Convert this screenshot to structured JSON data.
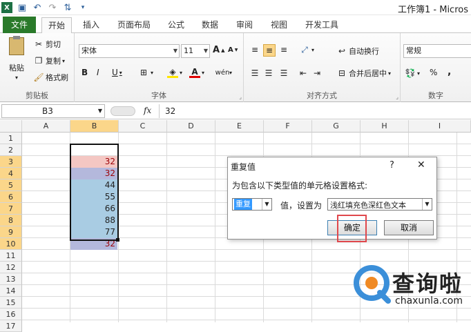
{
  "window": {
    "title": "工作簿1 - Micros"
  },
  "ribbon_tabs": [
    "文件",
    "开始",
    "插入",
    "页面布局",
    "公式",
    "数据",
    "审阅",
    "视图",
    "开发工具"
  ],
  "clipboard": {
    "paste": "粘贴",
    "cut": "剪切",
    "copy": "复制",
    "format_painter": "格式刷",
    "group": "剪贴板"
  },
  "font": {
    "name": "宋体",
    "size": "11",
    "grow": "A",
    "shrink": "A",
    "bold": "B",
    "italic": "I",
    "underline": "U",
    "group": "字体"
  },
  "alignment": {
    "wrap": "自动换行",
    "merge": "合并后居中",
    "group": "对齐方式"
  },
  "number": {
    "format": "常规",
    "percent": "%",
    "comma": ",",
    "group": "数字"
  },
  "formula_bar": {
    "cell_ref": "B3",
    "fx": "fx",
    "value": "32"
  },
  "columns": [
    "A",
    "B",
    "C",
    "D",
    "E",
    "F",
    "G",
    "H",
    "I"
  ],
  "rows": [
    "1",
    "2",
    "3",
    "4",
    "5",
    "6",
    "7",
    "8",
    "9",
    "10",
    "11",
    "12",
    "13",
    "14",
    "15",
    "16",
    "17"
  ],
  "cells": [
    {
      "row": "3",
      "value": "32",
      "highlight": true,
      "duplicate": true
    },
    {
      "row": "4",
      "value": "32",
      "highlight": true,
      "duplicate": true
    },
    {
      "row": "5",
      "value": "44",
      "highlight": false,
      "duplicate": false
    },
    {
      "row": "6",
      "value": "55",
      "highlight": false,
      "duplicate": false
    },
    {
      "row": "7",
      "value": "66",
      "highlight": false,
      "duplicate": false
    },
    {
      "row": "8",
      "value": "88",
      "highlight": false,
      "duplicate": false
    },
    {
      "row": "9",
      "value": "77",
      "highlight": false,
      "duplicate": false
    },
    {
      "row": "10",
      "value": "32",
      "highlight": true,
      "duplicate": true
    }
  ],
  "dialog": {
    "title": "重复值",
    "help": "?",
    "close": "✕",
    "prompt": "为包含以下类型值的单元格设置格式:",
    "type_value": "重复",
    "mid_label": "值，设置为",
    "format_value": "浅红填充色深红色文本",
    "ok": "确定",
    "cancel": "取消"
  },
  "watermark": {
    "brand": "查询啦",
    "url": "chaxunla.com"
  },
  "colors": {
    "file_tab": "#2a7a2a",
    "selection_header": "#fbd68a",
    "dup_fill": "#f4c7c3",
    "dup_text": "#9c0006",
    "blue_fill": "#a9cce3",
    "accent_box": "#e0474c"
  }
}
